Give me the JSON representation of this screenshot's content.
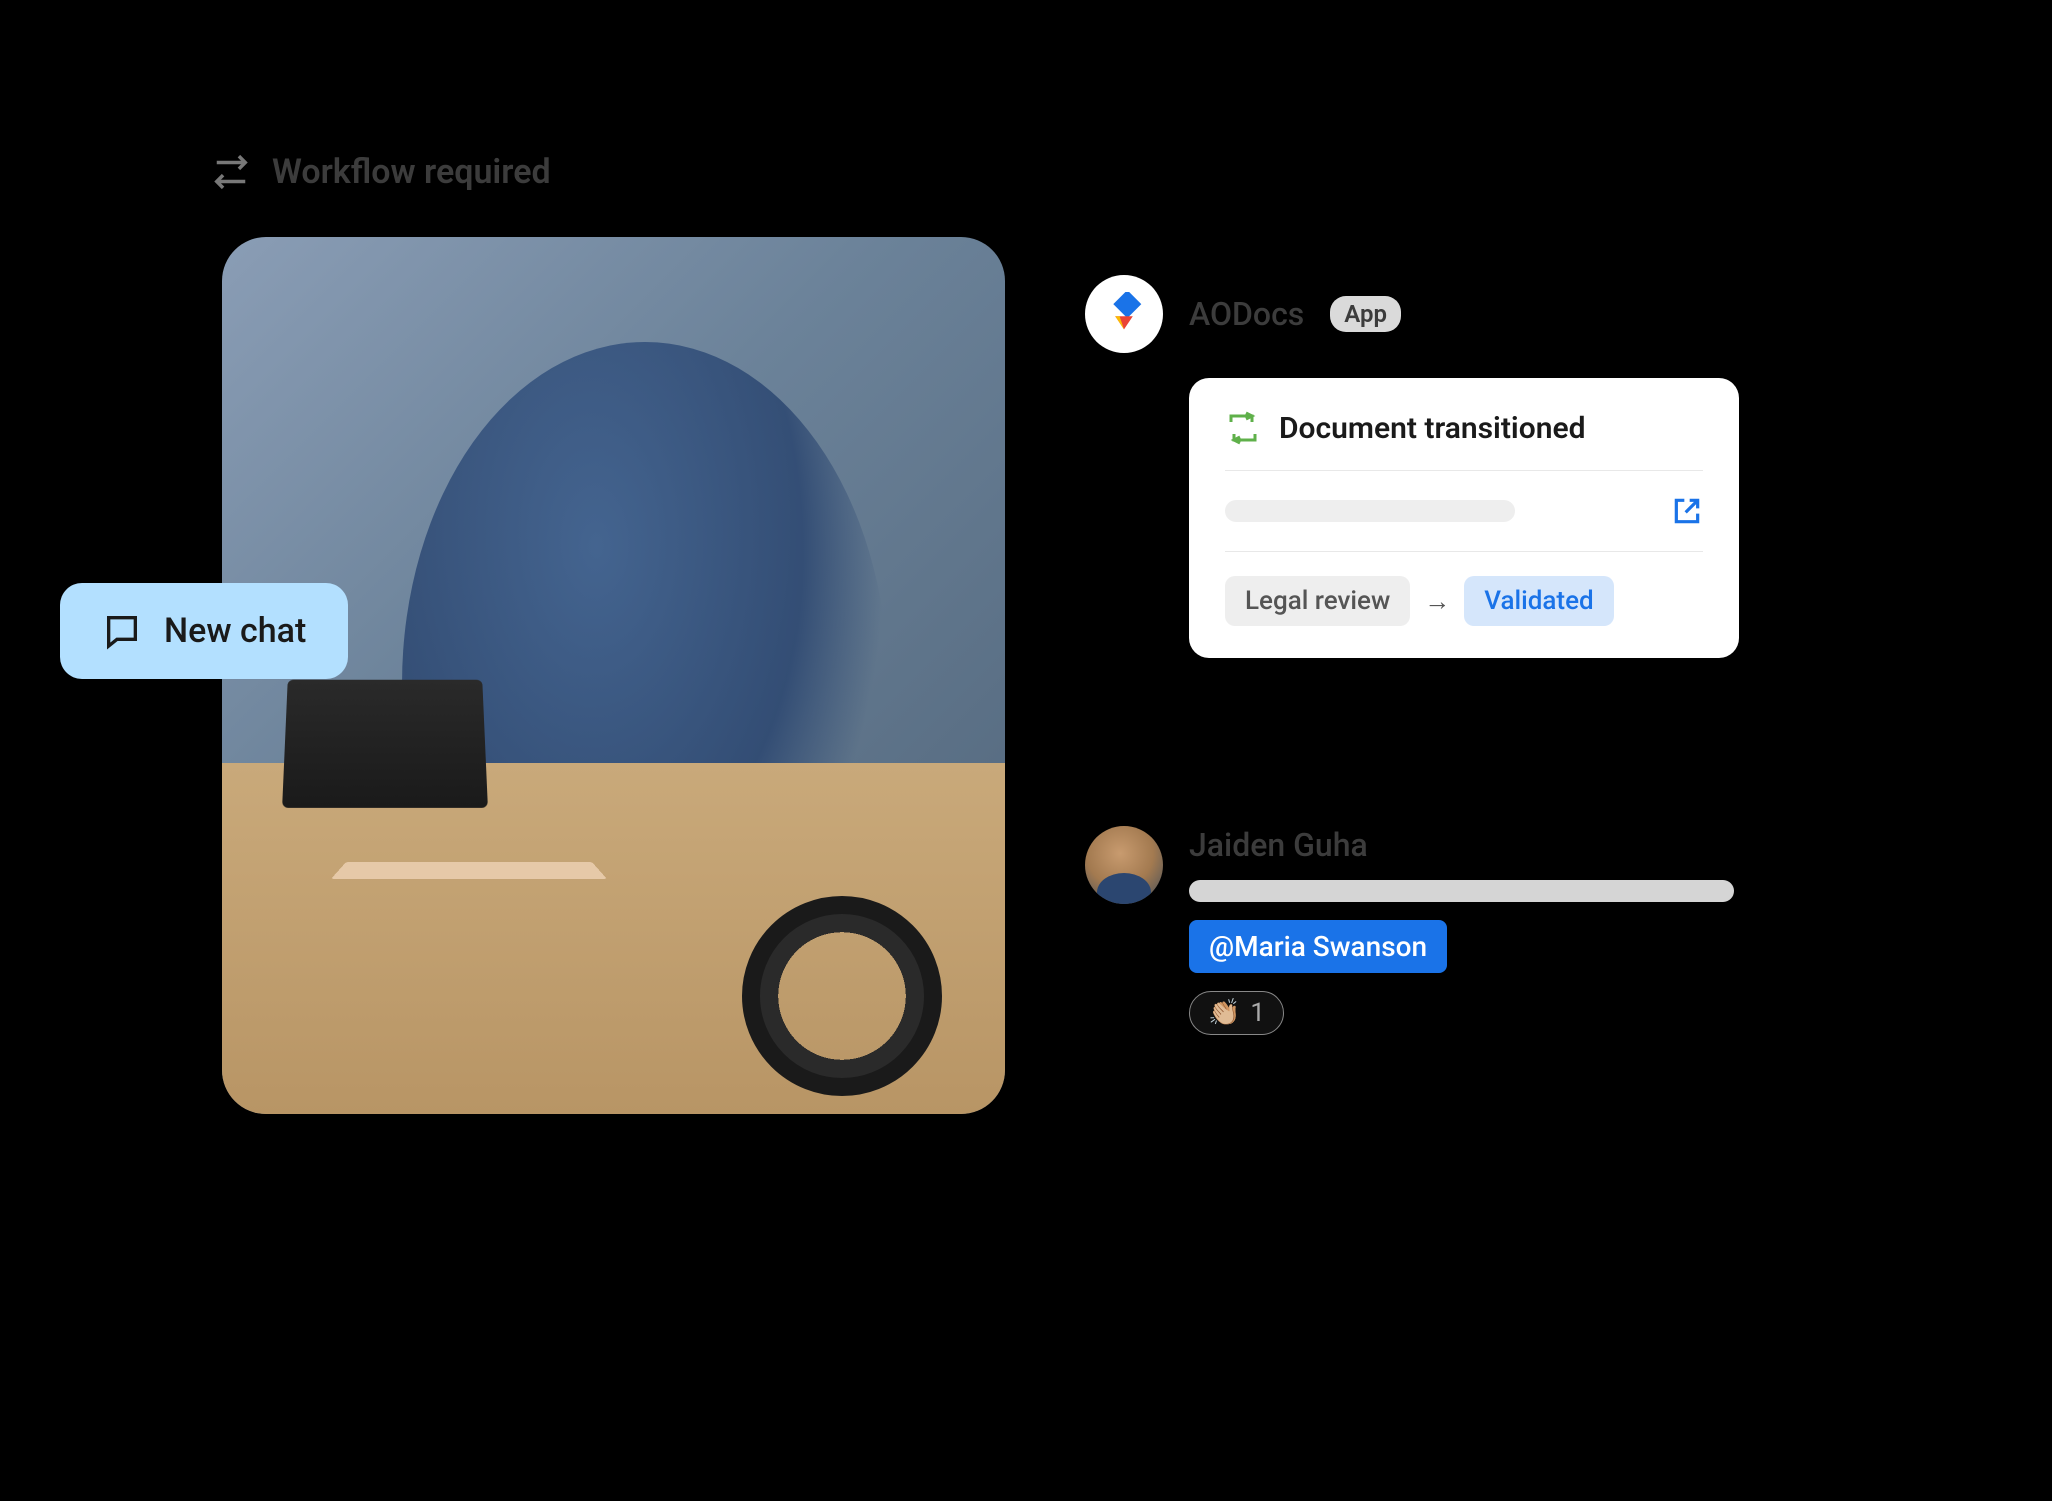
{
  "workflow": {
    "title": "Workflow required"
  },
  "newChat": {
    "label": "New chat"
  },
  "aodocs": {
    "name": "AODocs",
    "badge": "App"
  },
  "docCard": {
    "title": "Document transitioned",
    "statusFrom": "Legal review",
    "statusTo": "Validated",
    "arrow": "→"
  },
  "userMessage": {
    "name": "Jaiden Guha",
    "mention": "@Maria Swanson"
  },
  "reaction": {
    "emoji": "👏🏼",
    "count": "1"
  }
}
